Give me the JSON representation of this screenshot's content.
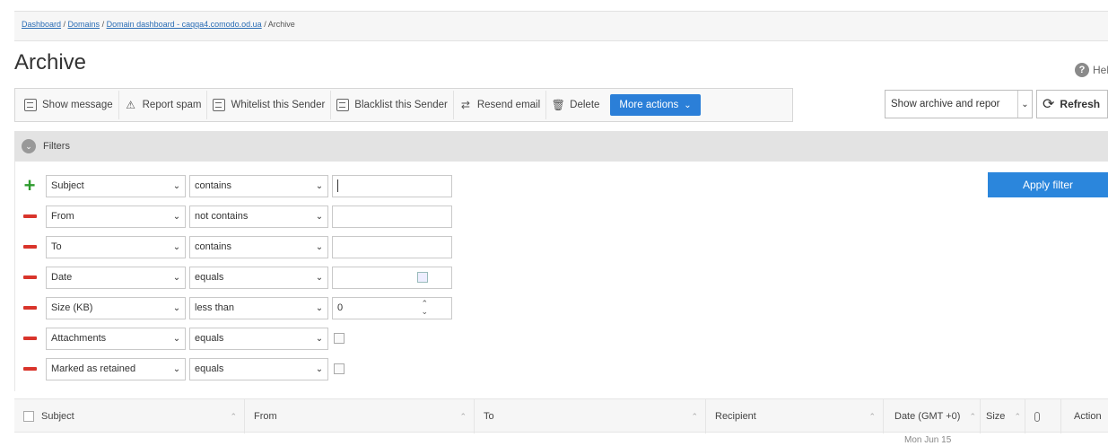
{
  "breadcrumb": {
    "items": [
      "Dashboard",
      "Domains",
      "Domain dashboard - caqqa4.comodo.od.ua"
    ],
    "separator": " / ",
    "current": "Archive"
  },
  "page": {
    "title": "Archive",
    "help": "Help"
  },
  "toolbar": {
    "show_message": "Show message",
    "report_spam": "Report spam",
    "whitelist": "Whitelist this Sender",
    "blacklist": "Blacklist this Sender",
    "resend": "Resend email",
    "delete": "Delete",
    "more_actions": "More actions"
  },
  "view_select": {
    "value": "Show archive and repor"
  },
  "refresh": "Refresh",
  "filters": {
    "title": "Filters",
    "apply": "Apply filter",
    "rows": [
      {
        "field": "Subject",
        "op": "contains",
        "value": ""
      },
      {
        "field": "From",
        "op": "not contains",
        "value": ""
      },
      {
        "field": "To",
        "op": "contains",
        "value": ""
      },
      {
        "field": "Date",
        "op": "equals",
        "value": ""
      },
      {
        "field": "Size (KB)",
        "op": "less than",
        "value": "0"
      },
      {
        "field": "Attachments",
        "op": "equals",
        "value": ""
      },
      {
        "field": "Marked as retained",
        "op": "equals",
        "value": ""
      }
    ]
  },
  "grid": {
    "columns": {
      "subject": "Subject",
      "from": "From",
      "to": "To",
      "recipient": "Recipient",
      "date": "Date (GMT +0)",
      "size": "Size",
      "actions": "Action"
    },
    "first_row_date": "Mon Jun 15"
  },
  "colors": {
    "accent": "#2b7fd8",
    "add": "#2e9b2e",
    "remove": "#d9342b"
  }
}
